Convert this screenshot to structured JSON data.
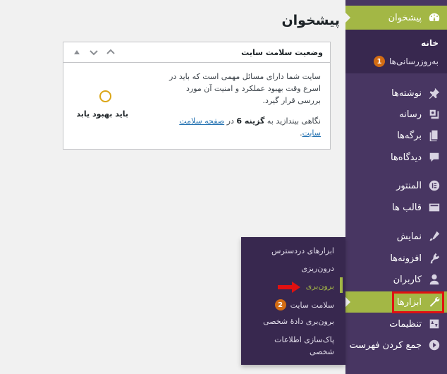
{
  "page": {
    "title": "پیشخوان"
  },
  "widget": {
    "title": "وضعیت سلامت سایت",
    "status_label": "باید بهبود یابد",
    "description": "سایت شما دارای مسائل مهمی است که باید در اسرع وقت بهبود عملکرد و امنیت آن مورد بررسی قرار گیرد.",
    "link_prefix": "نگاهی بیندازید به",
    "link_count": "گزینه 6",
    "link_middle": "در",
    "link_text": "صفحه سلامت سایت",
    "link_suffix": "."
  },
  "sidebar": {
    "dashboard": {
      "label": "پیشخوان",
      "icon": "dashboard-icon"
    },
    "dashboard_sub": {
      "home": "خانه",
      "updates": "به‌روزرسانی‌ها",
      "updates_badge": "1"
    },
    "items": [
      {
        "label": "نوشته‌ها",
        "icon": "pin-icon"
      },
      {
        "label": "رسانه",
        "icon": "media-icon"
      },
      {
        "label": "برگه‌ها",
        "icon": "pages-icon"
      },
      {
        "label": "دیدگاه‌ها",
        "icon": "comments-icon"
      },
      {
        "label": "المنتور",
        "icon": "elementor-icon"
      },
      {
        "label": "قالب ها",
        "icon": "templates-icon"
      },
      {
        "label": "نمایش",
        "icon": "appearance-icon"
      },
      {
        "label": "افزونه‌ها",
        "icon": "plugins-icon"
      },
      {
        "label": "کاربران",
        "icon": "users-icon"
      },
      {
        "label": "ابزارها",
        "icon": "tools-icon"
      },
      {
        "label": "تنظیمات",
        "icon": "settings-icon"
      },
      {
        "label": "جمع کردن فهرست",
        "icon": "collapse-icon"
      }
    ]
  },
  "flyout": {
    "items": [
      {
        "label": "ابزارهای دردسترس"
      },
      {
        "label": "درون‌ریزی"
      },
      {
        "label": "برون‌بری",
        "active": true
      },
      {
        "label": "سلامت سایت",
        "badge": "2"
      },
      {
        "label": "برون‌بری دادهٔ شخصی"
      },
      {
        "label": "پاک‌سازی اطلاعات شخصی"
      }
    ]
  },
  "colors": {
    "sidebar_bg": "#483662",
    "submenu_bg": "#38284f",
    "accent": "#a3b745",
    "badge": "#d36c13",
    "highlight": "#e01111",
    "link": "#2271b1"
  }
}
